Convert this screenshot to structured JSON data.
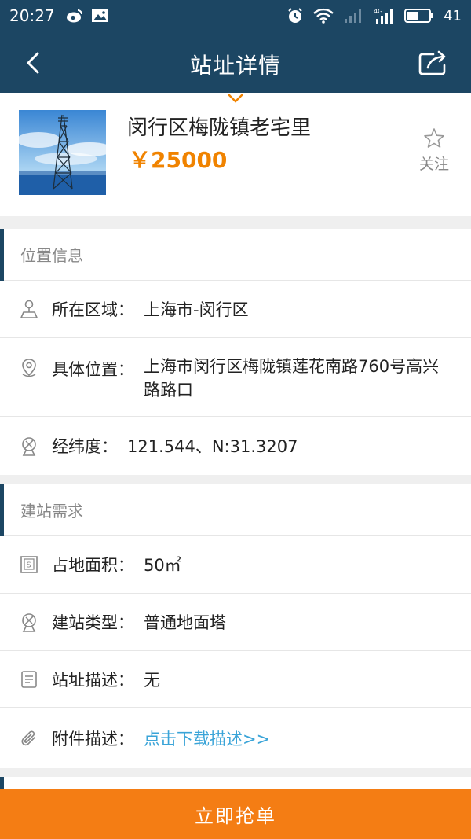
{
  "status_bar": {
    "time": "20:27",
    "battery": "41",
    "icons": [
      "weibo-icon",
      "image-icon",
      "alarm-icon",
      "wifi-icon",
      "signal-icon",
      "4g-signal-icon",
      "battery-icon"
    ]
  },
  "nav": {
    "title": "站址详情",
    "back_icon": "back-arrow-icon",
    "share_icon": "share-icon"
  },
  "site": {
    "name": "闵行区梅陇镇老宅里",
    "price": "￥25000",
    "follow_label": "关注",
    "thumbnail": "tower-photo"
  },
  "location": {
    "header": "位置信息",
    "items": [
      {
        "label": "所在区域：",
        "value": "上海市-闵行区",
        "icon": "map-pin-stand-icon"
      },
      {
        "label": "具体位置：",
        "value": "上海市闵行区梅陇镇莲花南路760号高兴路路口",
        "icon": "location-pin-icon"
      },
      {
        "label": "经纬度：",
        "value": "121.544、N:31.3207",
        "icon": "satellite-dish-icon"
      }
    ]
  },
  "requirements": {
    "header": "建站需求",
    "items": [
      {
        "label": "占地面积：",
        "value": "50㎡",
        "icon": "area-icon"
      },
      {
        "label": "建站类型：",
        "value": "普通地面塔",
        "icon": "satellite-dish-icon"
      },
      {
        "label": "站址描述：",
        "value": "无",
        "icon": "document-icon"
      },
      {
        "label": "附件描述：",
        "value": "点击下载描述>>",
        "icon": "paperclip-icon"
      }
    ]
  },
  "colors": {
    "header_bg": "#1c4663",
    "price": "#f08300",
    "link": "#3aa4d8",
    "button_bg": "#f47d14"
  },
  "action": {
    "button_label": "立即抢单"
  }
}
